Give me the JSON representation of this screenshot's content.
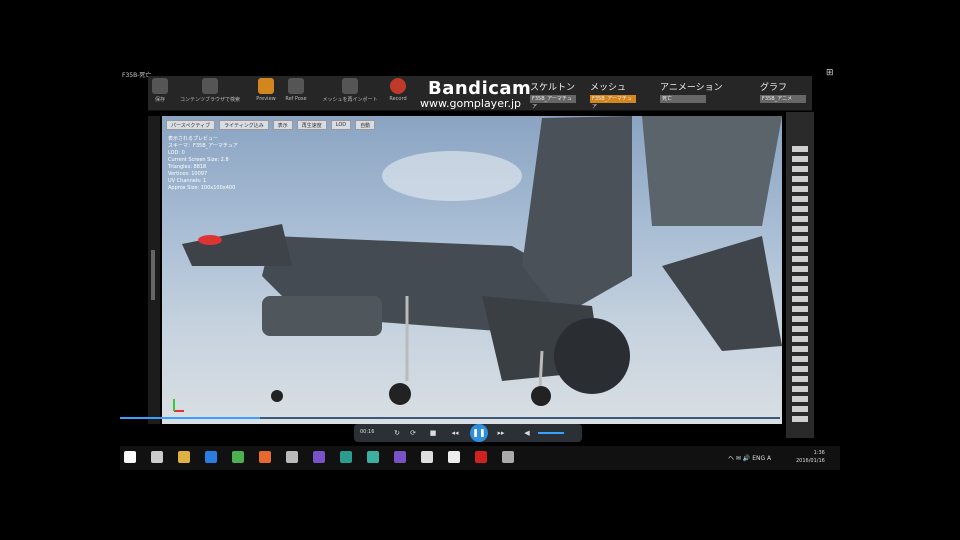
{
  "window": {
    "title": "F35B-死亡",
    "snap_icon": "arrange-icon"
  },
  "toolbar": {
    "buttons": [
      {
        "label": "保存",
        "icon": "save-icon"
      },
      {
        "label": "コンテンツブラウザで検索",
        "icon": "search-icon"
      },
      {
        "label": "Preview",
        "icon": "preview-icon"
      },
      {
        "label": "Ref Pose",
        "icon": "refpose-icon"
      },
      {
        "label": "メッシュを再インポート",
        "icon": "reimport-icon"
      },
      {
        "label": "Record",
        "icon": "record-icon"
      }
    ],
    "modes": [
      {
        "label": "スケルトン",
        "value": "F35B_アーマチュア"
      },
      {
        "label": "メッシュ",
        "value": "F35B_アーマチュア"
      },
      {
        "label": "アニメーション",
        "value": "死亡"
      },
      {
        "label": "グラフ",
        "value": "F35B_アニメ"
      }
    ]
  },
  "watermark": {
    "title": "Bandicam",
    "url": "www.gomplayer.jp"
  },
  "viewport": {
    "buttons": [
      "パースペクティブ",
      "ライティング込み",
      "表示",
      "再生速度",
      "LOD",
      "自動"
    ],
    "stats": [
      "表示されるプレビュー",
      "スキーマ：F35B_アーマチュア",
      "LOD: 0",
      "Current Screen Size: 2.8",
      "Triangles: 8818",
      "Vertices: 10097",
      "UV Channels: 1",
      "Approx Size: 100x100x400"
    ]
  },
  "player": {
    "time": "00:16",
    "play_icon": "pause-icon"
  },
  "taskbar": {
    "icons": [
      "windows-start-icon",
      "task-view-icon",
      "file-explorer-icon",
      "edge-icon",
      "chrome-icon",
      "firefox-icon",
      "unity-icon",
      "visual-studio-icon",
      "store-icon",
      "app-icon",
      "vs-icon",
      "ue4-icon",
      "unreal-icon",
      "bandicam-icon",
      "gom-icon"
    ],
    "clock_time": "1:36",
    "clock_date": "2016/01/16",
    "tray_text": "ヘ ✉ 🔊 ENG A"
  }
}
